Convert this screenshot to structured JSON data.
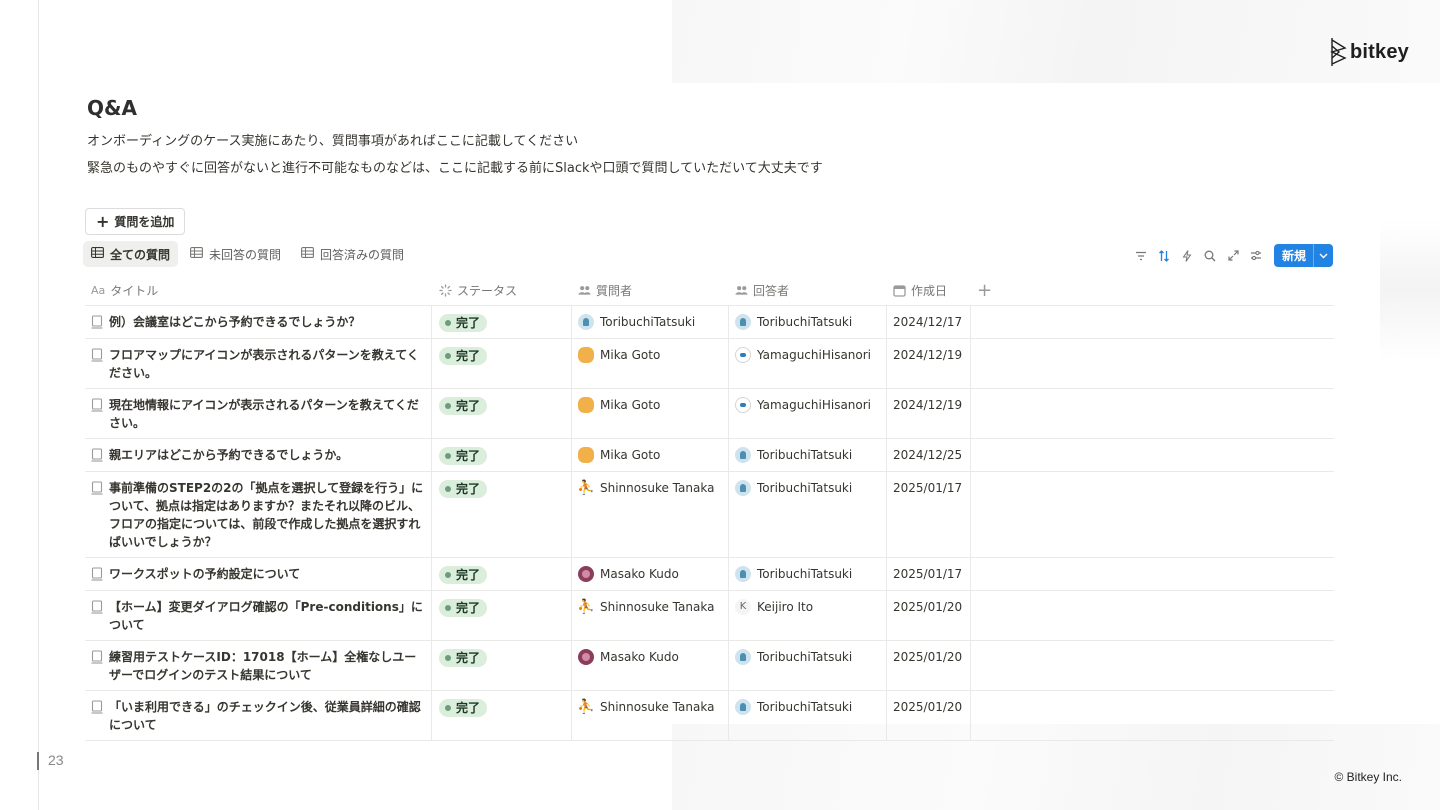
{
  "slide": {
    "logo_text": "bitkey",
    "page_number": "23",
    "copyright": "© Bitkey Inc."
  },
  "page": {
    "title": "Q&A",
    "description_1": "オンボーディングのケース実施にあたり、質問事項があればここに記載してください",
    "description_2": "緊急のものやすぐに回答がないと進行不可能なものなどは、ここに記載する前にSlackや口頭で質問していただいて大丈夫です"
  },
  "add_question_label": "質問を追加",
  "tabs": [
    {
      "label": "全ての質問",
      "active": true
    },
    {
      "label": "未回答の質問",
      "active": false
    },
    {
      "label": "回答済みの質問",
      "active": false
    }
  ],
  "toolbar": {
    "icons": [
      "filter-icon",
      "sort-icon",
      "lightning-icon",
      "search-icon",
      "expand-icon",
      "settings-sliders-icon"
    ],
    "new_label": "新規"
  },
  "columns": {
    "title": "タイトル",
    "status": "ステータス",
    "asker": "質問者",
    "answerer": "回答者",
    "date": "作成日",
    "title_prefix": "Aa"
  },
  "status_color": "#dbeddb",
  "accent_color": "#2383e2",
  "rows": [
    {
      "title": "例）会議室はどこから予約できるでしょうか？",
      "status": "完了",
      "asker": "ToribuchiTatsuki",
      "asker_avatar": "tori",
      "answerer": "ToribuchiTatsuki",
      "answerer_avatar": "tori",
      "date": "2024/12/17"
    },
    {
      "title": "フロアマップにアイコンが表示されるパターンを教えてください。",
      "status": "完了",
      "asker": "Mika Goto",
      "asker_avatar": "mika",
      "answerer": "YamaguchiHisanori",
      "answerer_avatar": "yama",
      "date": "2024/12/19"
    },
    {
      "title": "現在地情報にアイコンが表示されるパターンを教えてください。",
      "status": "完了",
      "asker": "Mika Goto",
      "asker_avatar": "mika",
      "answerer": "YamaguchiHisanori",
      "answerer_avatar": "yama",
      "date": "2024/12/19"
    },
    {
      "title": "親エリアはどこから予約できるでしょうか。",
      "status": "完了",
      "asker": "Mika Goto",
      "asker_avatar": "mika",
      "answerer": "ToribuchiTatsuki",
      "answerer_avatar": "tori",
      "date": "2024/12/25"
    },
    {
      "title": "事前準備のSTEP2の2の「拠点を選択して登録を行う」について、拠点は指定はありますか？またそれ以降のビル、フロアの指定については、前段で作成した拠点を選択すればいいでしょうか？",
      "status": "完了",
      "asker": "Shinnosuke Tanaka",
      "asker_avatar": "shin",
      "answerer": "ToribuchiTatsuki",
      "answerer_avatar": "tori",
      "date": "2025/01/17"
    },
    {
      "title": "ワークスポットの予約設定について",
      "status": "完了",
      "asker": "Masako Kudo",
      "asker_avatar": "masa",
      "answerer": "ToribuchiTatsuki",
      "answerer_avatar": "tori",
      "date": "2025/01/17"
    },
    {
      "title": "【ホーム】変更ダイアログ確認の「Pre-conditions」について",
      "status": "完了",
      "asker": "Shinnosuke Tanaka",
      "asker_avatar": "shin",
      "answerer": "Keijiro Ito",
      "answerer_avatar": "kei",
      "date": "2025/01/20"
    },
    {
      "title": "練習用テストケースID：17018【ホーム】全権なしユーザーでログインのテスト結果について",
      "status": "完了",
      "asker": "Masako Kudo",
      "asker_avatar": "masa",
      "answerer": "ToribuchiTatsuki",
      "answerer_avatar": "tori",
      "date": "2025/01/20"
    },
    {
      "title": "「いま利用できる」のチェックイン後、従業員詳細の確認について",
      "status": "完了",
      "asker": "Shinnosuke Tanaka",
      "asker_avatar": "shin",
      "answerer": "ToribuchiTatsuki",
      "answerer_avatar": "tori",
      "date": "2025/01/20"
    }
  ],
  "avatar_letters": {
    "kei": "K",
    "shin": "⛹"
  }
}
